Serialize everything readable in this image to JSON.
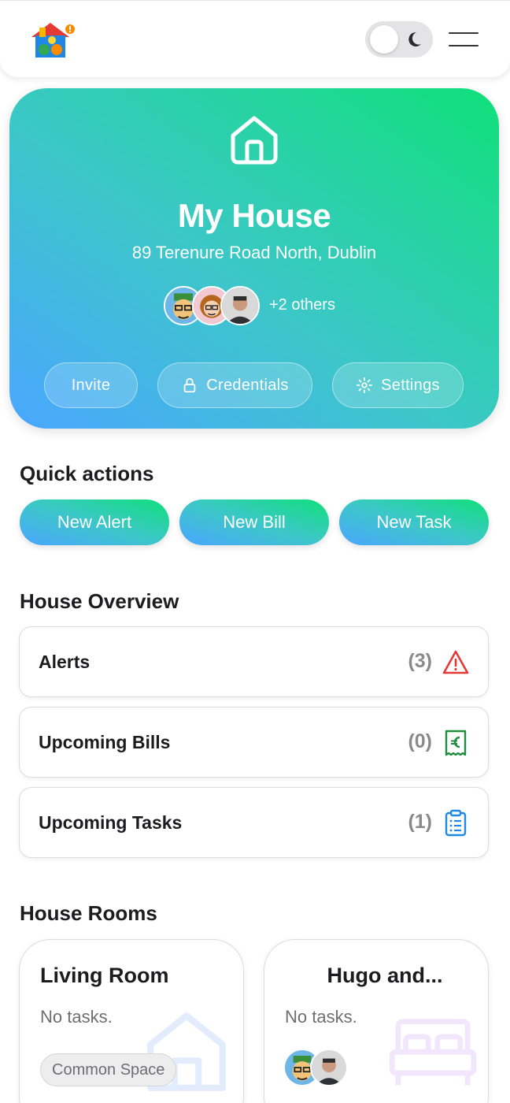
{
  "header": {
    "logo_icon": "house-logo-icon",
    "theme_toggle_icon": "moon-icon",
    "menu_icon": "hamburger-icon"
  },
  "house": {
    "icon": "house-icon",
    "name": "My House",
    "address": "89 Terenure Road North, Dublin",
    "members_extra": "+2 others",
    "actions": {
      "invite": "Invite",
      "credentials": "Credentials",
      "settings": "Settings"
    }
  },
  "quick_actions": {
    "title": "Quick actions",
    "buttons": [
      "New Alert",
      "New Bill",
      "New Task"
    ]
  },
  "overview": {
    "title": "House Overview",
    "rows": [
      {
        "label": "Alerts",
        "count": "(3)",
        "icon": "warning-triangle-icon",
        "color": "#e53935"
      },
      {
        "label": "Upcoming Bills",
        "count": "(0)",
        "icon": "euro-receipt-icon",
        "color": "#1e8e3e"
      },
      {
        "label": "Upcoming Tasks",
        "count": "(1)",
        "icon": "clipboard-list-icon",
        "color": "#1e88e5"
      }
    ]
  },
  "rooms": {
    "title": "House Rooms",
    "items": [
      {
        "name": "Living Room",
        "status": "No tasks.",
        "tag": "Common Space",
        "icon": "house-icon"
      },
      {
        "name": "Hugo and...",
        "status": "No tasks.",
        "icon": "bed-icon"
      }
    ]
  },
  "colors": {
    "gradient_start": "#4aa6ff",
    "gradient_mid": "#3cc7c8",
    "gradient_end": "#10e07a"
  }
}
